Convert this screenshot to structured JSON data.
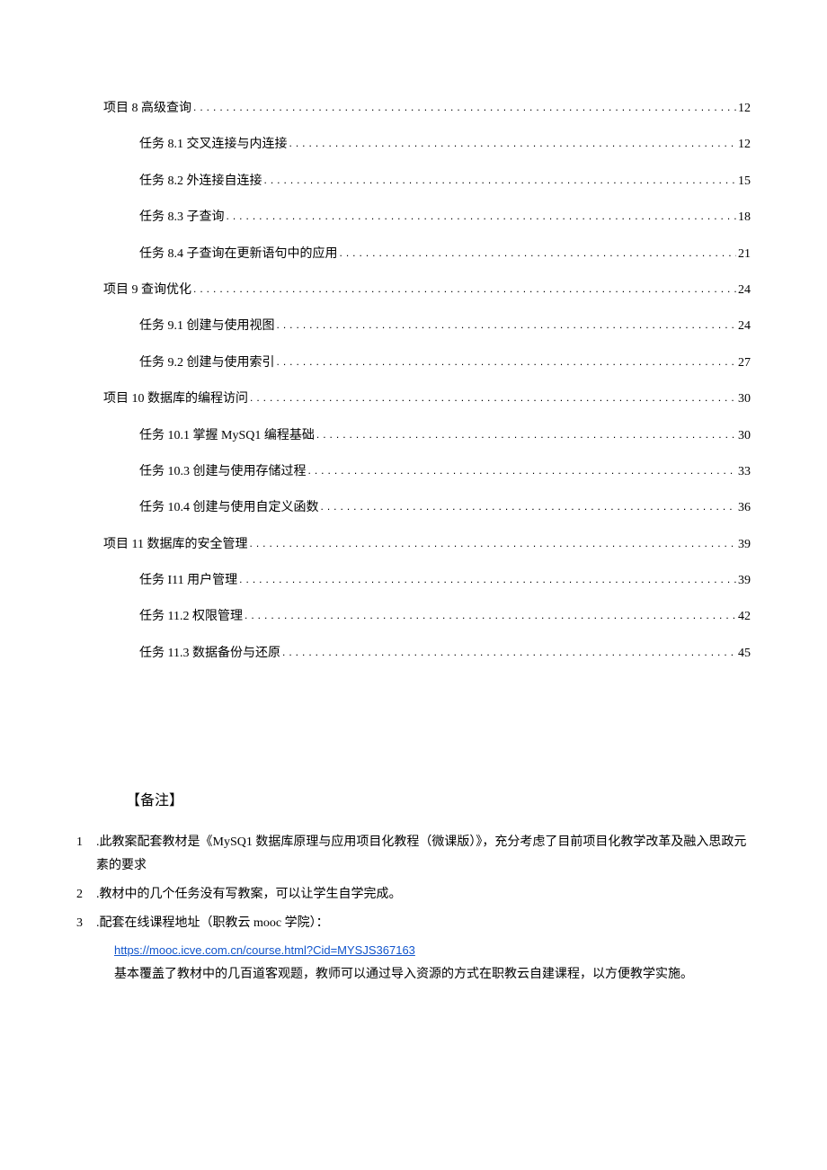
{
  "toc": [
    {
      "level": "chapter",
      "label": "项目 8 高级查询",
      "page": "12"
    },
    {
      "level": "task",
      "label": "任务 8.1 交叉连接与内连接",
      "page": "12"
    },
    {
      "level": "task",
      "label": "任务 8.2 外连接自连接",
      "page": "15"
    },
    {
      "level": "task",
      "label": "任务 8.3 子查询",
      "page": "18"
    },
    {
      "level": "task",
      "label": "任务 8.4 子查询在更新语句中的应用",
      "page": "21"
    },
    {
      "level": "chapter",
      "label": "项目 9 查询优化",
      "page": "24"
    },
    {
      "level": "task",
      "label": "任务 9.1 创建与使用视图",
      "page": "24"
    },
    {
      "level": "task",
      "label": "任务 9.2 创建与使用索引",
      "page": "27"
    },
    {
      "level": "chapter",
      "label": "项目 10 数据库的编程访问",
      "page": "30"
    },
    {
      "level": "task",
      "label": "任务 10.1 掌握 MySQ1 编程基础",
      "page": "30"
    },
    {
      "level": "task",
      "label": "任务 10.3 创建与使用存储过程",
      "page": "33"
    },
    {
      "level": "task",
      "label": "任务 10.4 创建与使用自定义函数",
      "page": "36"
    },
    {
      "level": "chapter",
      "label": "项目 11 数据库的安全管理",
      "page": "39"
    },
    {
      "level": "task",
      "label": "任务 I11 用户管理",
      "page": "39"
    },
    {
      "level": "task",
      "label": "任务 11.2 权限管理",
      "page": "42"
    },
    {
      "level": "task",
      "label": "任务 11.3 数据备份与还原",
      "page": "45"
    }
  ],
  "notes": {
    "heading": "【备注】",
    "items": [
      {
        "num": "1",
        "text": ".此教案配套教材是《MySQ1 数据库原理与应用项目化教程（微课版）》，充分考虑了目前项目化教学改革及融入思政元素的要求"
      },
      {
        "num": "2",
        "text": ".教材中的几个任务没有写教案，可以让学生自学完成。"
      },
      {
        "num": "3",
        "text": ".配套在线课程地址（职教云 mooc 学院）：",
        "link": "https://mooc.icve.com.cn/course.html?Cid=MYSJS367163",
        "after": "基本覆盖了教材中的几百道客观题，教师可以通过导入资源的方式在职教云自建课程，以方便教学实施。"
      }
    ]
  }
}
